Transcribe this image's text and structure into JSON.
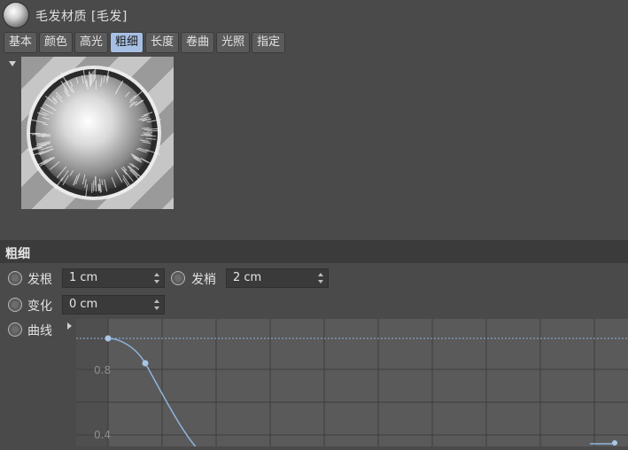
{
  "header": {
    "title": "毛发材质 [毛发]",
    "icon": "material-sphere-icon"
  },
  "tabs": [
    {
      "label": "基本",
      "active": false
    },
    {
      "label": "颜色",
      "active": false
    },
    {
      "label": "高光",
      "active": false
    },
    {
      "label": "粗细",
      "active": true
    },
    {
      "label": "长度",
      "active": false
    },
    {
      "label": "卷曲",
      "active": false
    },
    {
      "label": "光照",
      "active": false
    },
    {
      "label": "指定",
      "active": false
    }
  ],
  "section": {
    "title": "粗细"
  },
  "params": {
    "root": {
      "label": "发根",
      "value": "1 cm"
    },
    "tip": {
      "label": "发梢",
      "value": "2 cm"
    },
    "variation": {
      "label": "变化",
      "value": "0 cm"
    },
    "curve": {
      "label": "曲线"
    }
  },
  "graph": {
    "tick_labels": [
      "0.8",
      "0.4"
    ],
    "curve_color": "#8fb4dc",
    "grid_color": "#3c3c3c",
    "background": "#5a5a5a"
  },
  "colors": {
    "active_tab": "#a7bfe2",
    "panel_bg": "#4a4a4a"
  }
}
